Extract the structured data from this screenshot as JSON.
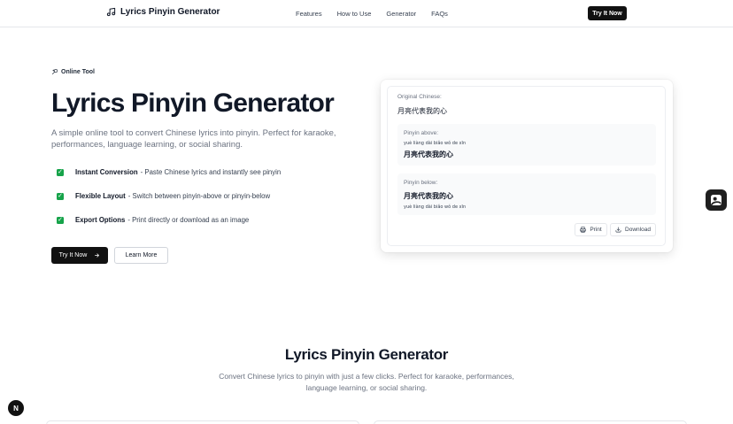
{
  "header": {
    "brand": "Lyrics Pinyin Generator",
    "nav": [
      "Features",
      "How to Use",
      "Generator",
      "FAQs"
    ],
    "cta": "Try It Now"
  },
  "hero": {
    "badge": "Online Tool",
    "title": "Lyrics Pinyin Generator",
    "description": "A simple online tool to convert Chinese lyrics into pinyin. Perfect for karaoke, performances, language learning, or social sharing.",
    "features": [
      {
        "title": "Instant Conversion",
        "text": "- Paste Chinese lyrics and instantly see pinyin"
      },
      {
        "title": "Flexible Layout",
        "text": "- Switch between pinyin-above or pinyin-below"
      },
      {
        "title": "Export Options",
        "text": "- Print directly or download as an image"
      }
    ],
    "primary_button": "Try It Now",
    "secondary_button": "Learn More"
  },
  "preview": {
    "original_label": "Original Chinese:",
    "original_text": "月亮代表我的心",
    "above_label": "Pinyin above:",
    "above_pinyin": "yuè liàng dài biǎo wǒ de xīn",
    "above_hanzi": "月亮代表我的心",
    "below_label": "Pinyin below:",
    "below_hanzi": "月亮代表我的心",
    "below_pinyin": "yuè liàng dài biǎo wǒ de xīn",
    "print_label": "Print",
    "download_label": "Download"
  },
  "section": {
    "title": "Lyrics Pinyin Generator",
    "description": "Convert Chinese lyrics to pinyin with just a few clicks. Perfect for karaoke, performances, language learning, or social sharing."
  },
  "next_badge": "N",
  "icons": {
    "brand": "music-note-icon",
    "badge": "mic-icon",
    "check": "check-icon",
    "arrow": "arrow-right-icon",
    "print": "printer-icon",
    "download": "download-icon",
    "widget": "assistant-icon"
  },
  "colors": {
    "primary": "#111111",
    "check": "#16a34a",
    "muted": "#6b7280"
  }
}
